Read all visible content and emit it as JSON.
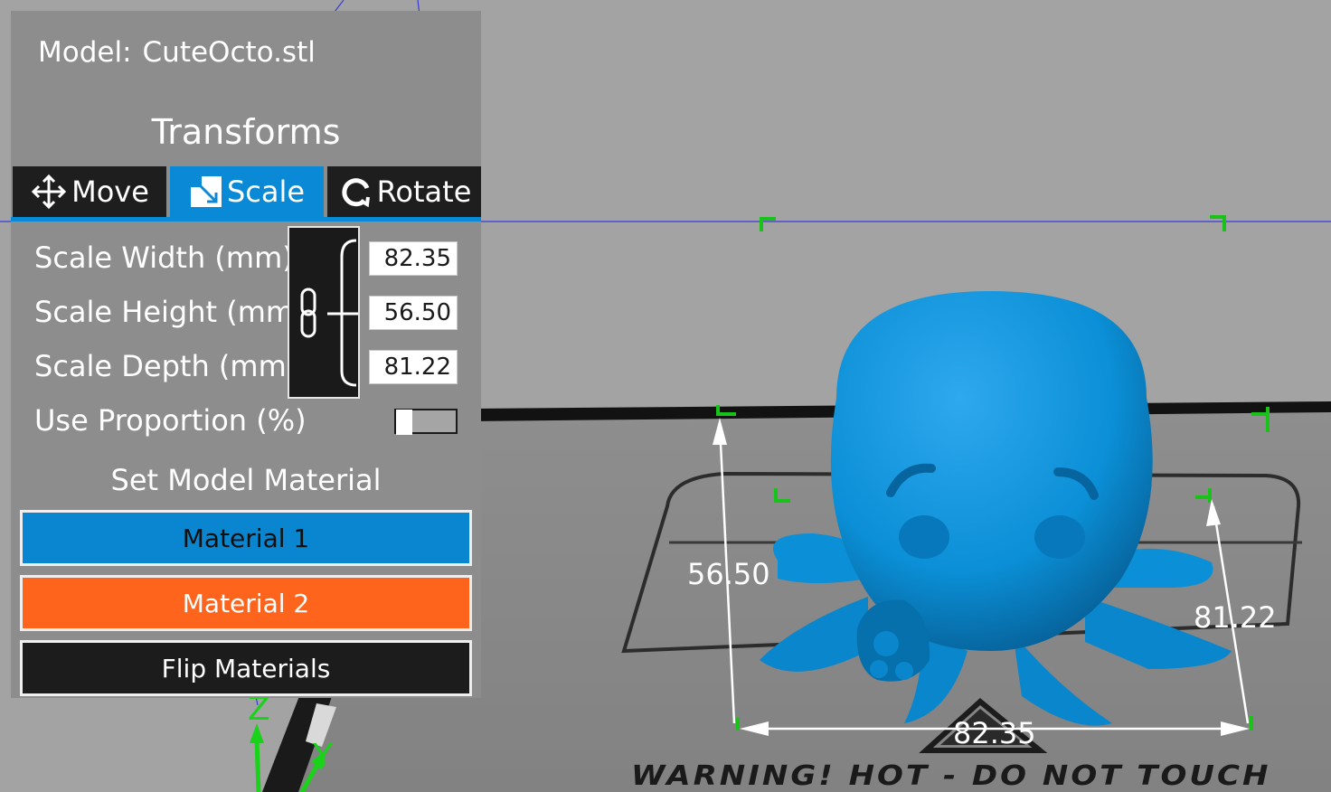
{
  "panel": {
    "model_label": "Model:",
    "model_name": "CuteOcto.stl",
    "title": "Transforms",
    "tabs": [
      {
        "label": "Move",
        "icon": "move-arrows-icon",
        "active": false
      },
      {
        "label": "Scale",
        "icon": "scale-icon",
        "active": true
      },
      {
        "label": "Rotate",
        "icon": "rotate-icon",
        "active": false
      }
    ],
    "fields": [
      {
        "label": "Scale Width (mm)",
        "value": "82.35"
      },
      {
        "label": "Scale Height (mm)",
        "value": "56.50"
      },
      {
        "label": "Scale Depth (mm)",
        "value": "81.22"
      }
    ],
    "proportion_label": "Use Proportion (%)",
    "proportion_enabled": false,
    "material_section": "Set Model Material",
    "buttons": {
      "material1": "Material 1",
      "material2": "Material 2",
      "flip": "Flip Materials"
    }
  },
  "viewport": {
    "dimensions": {
      "width": "82.35",
      "height": "56.50",
      "depth": "81.22"
    },
    "bed_warning": "WARNING! HOT - DO NOT TOUCH",
    "axes": {
      "z": "Z",
      "y": "Y"
    },
    "colors": {
      "background": "#a3a3a3",
      "model": "#0b8fd6",
      "bed": "#8b8b8b",
      "bracket": "#19c219",
      "material1": "#0a85cf",
      "material2": "#fe641b",
      "accent": "#0a8ad6"
    }
  }
}
